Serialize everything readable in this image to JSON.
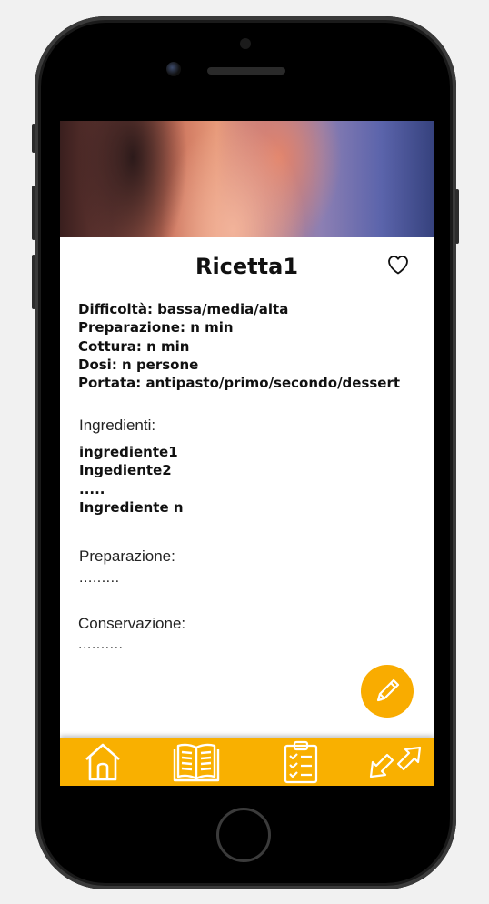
{
  "recipe": {
    "title": "Ricetta1",
    "info": [
      "Difficoltà: bassa/media/alta",
      "Preparazione: n min",
      "Cottura: n min",
      "Dosi: n persone",
      "Portata: antipasto/primo/secondo/dessert"
    ],
    "ingredients_label": "Ingredienti:",
    "ingredients": [
      "ingrediente1",
      "Ingediente2",
      ".....",
      "Ingrediente n"
    ],
    "preparation_label": "Preparazione:",
    "preparation_text": ".........",
    "storage_label": "Conservazione:",
    "storage_text": ".........."
  },
  "icons": {
    "favorite": "heart-outline-icon",
    "edit": "pencil-icon",
    "nav": [
      "home-icon",
      "book-icon",
      "clipboard-checklist-icon",
      "shuffle-arrows-icon"
    ]
  },
  "colors": {
    "accent": "#f9b000",
    "fab": "#f9ac00",
    "text": "#111111"
  }
}
